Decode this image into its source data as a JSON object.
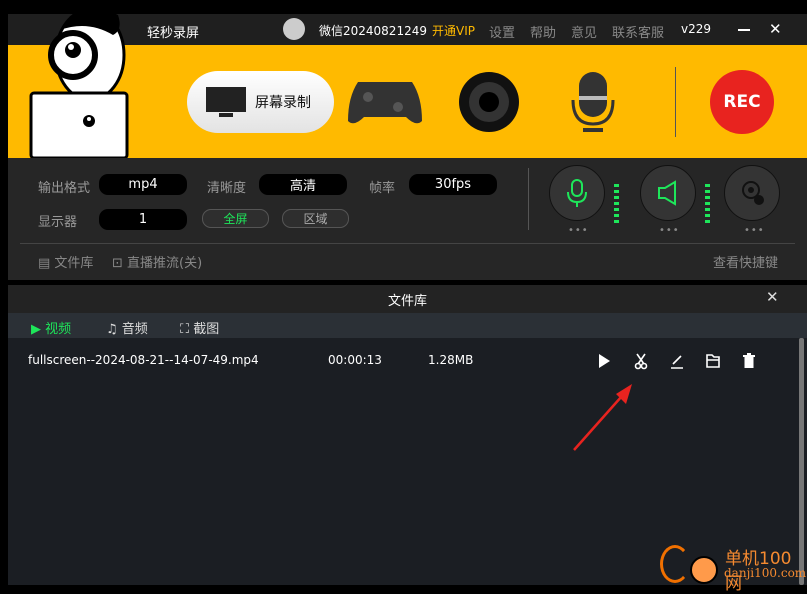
{
  "app": {
    "title": "轻秒录屏",
    "user": "微信20240821249",
    "vip": "开通VIP",
    "menu": [
      "设置",
      "帮助",
      "意见",
      "联系客服"
    ],
    "version": "v229"
  },
  "modes": {
    "screen": "屏幕录制",
    "rec": "REC"
  },
  "settings": {
    "format_label": "输出格式",
    "format": "mp4",
    "quality_label": "清晰度",
    "quality": "高清",
    "fps_label": "帧率",
    "fps": "30fps",
    "display_label": "显示器",
    "display": "1",
    "fullscreen": "全屏",
    "region": "区域",
    "dots": "•••"
  },
  "bottom": {
    "library": "文件库",
    "live": "直播推流(关)",
    "shortcuts": "查看快捷键"
  },
  "library": {
    "title": "文件库",
    "tabs": [
      "视频",
      "音频",
      "截图"
    ],
    "files": [
      {
        "name": "fullscreen--2024-08-21--14-07-49.mp4",
        "duration": "00:00:13",
        "size": "1.28MB"
      }
    ]
  },
  "colors": {
    "accent": "#ffba00",
    "green": "#1ee65a",
    "rec": "#e8231f",
    "vip": "#ffba00"
  },
  "watermark": {
    "text": "单机100网",
    "url": "danji100.com"
  }
}
